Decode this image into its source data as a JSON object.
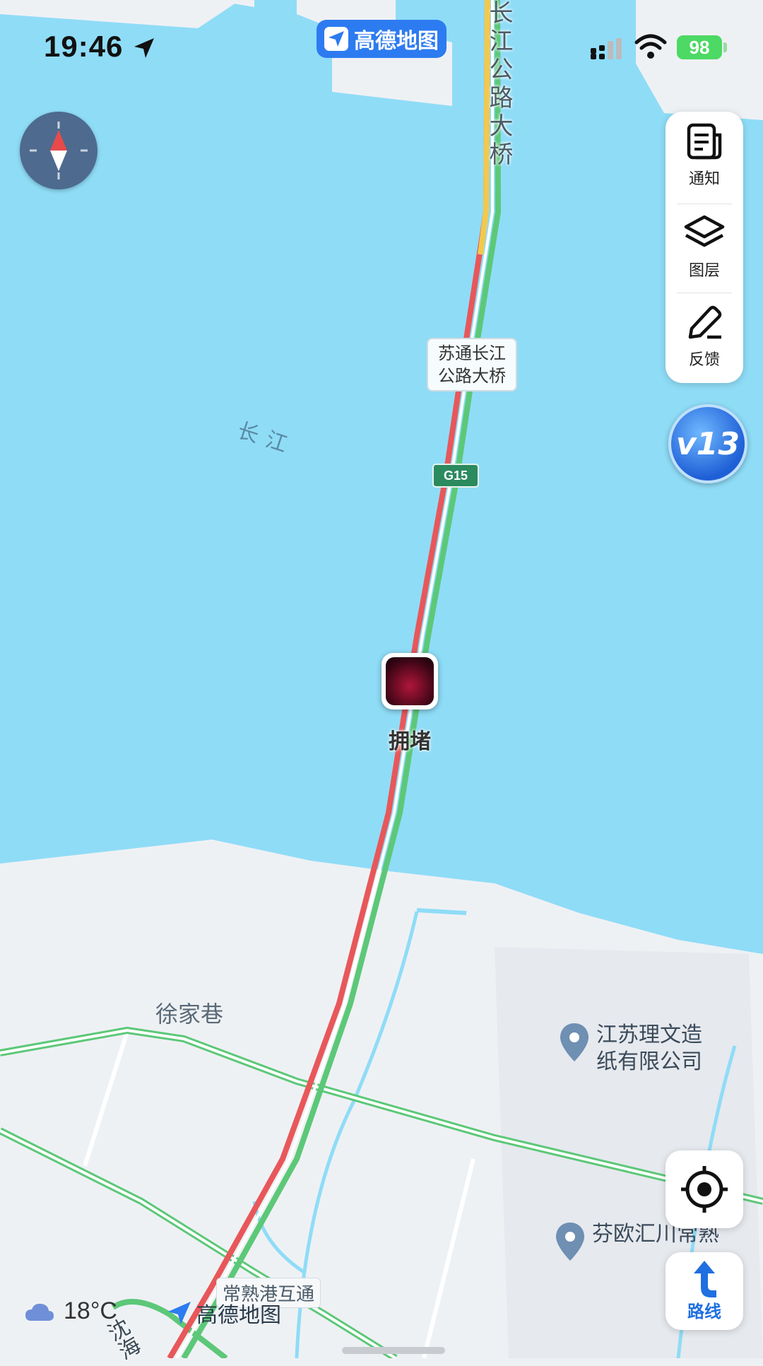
{
  "status_bar": {
    "time": "19:46",
    "app_badge": "高德地图",
    "battery": "98"
  },
  "map": {
    "river_labels": [
      "长江",
      "长江公路大桥"
    ],
    "bridge_name": "苏通长江公路大桥",
    "bridge_name_lines": [
      "苏通长江",
      "公路大桥"
    ],
    "highway_shield": "G15",
    "camera_label": "拥堵",
    "places": {
      "village": "徐家巷",
      "poi_1_lines": [
        "江苏理文造",
        "纸有限公司"
      ],
      "poi_2": "芬欧汇川常熟",
      "interchange": "常熟港互通",
      "road_fragment": "沈海"
    },
    "colors": {
      "water": "#8fdcf7",
      "land": "#eef1f4",
      "congested": "#e8575a",
      "slow": "#f2c94c",
      "clear": "#5cc878"
    }
  },
  "controls": {
    "notify_label": "通知",
    "layers_label": "图层",
    "feedback_label": "反馈",
    "v13_badge": "v13",
    "route_label": "路线",
    "icons": {
      "compass": "compass-icon",
      "notify": "notification-icon",
      "layers": "layers-icon",
      "feedback": "pencil-icon",
      "locate": "locate-icon",
      "route": "route-arrow-icon"
    }
  },
  "footer": {
    "temperature": "18°C",
    "watermark": "高德地图"
  }
}
